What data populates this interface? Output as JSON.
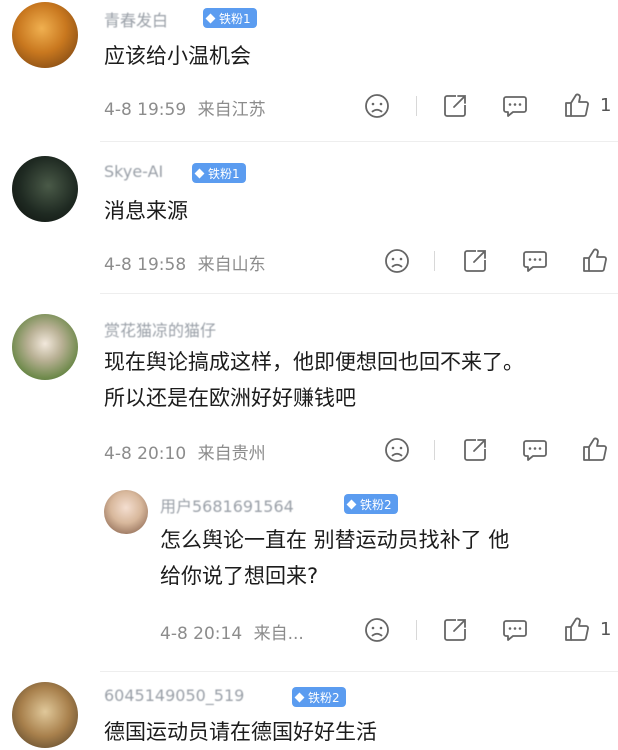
{
  "comments": [
    {
      "username": "青春发白",
      "badge": "铁粉1",
      "text_lines": [
        "应该给小温机会"
      ],
      "time": "4-8 19:59",
      "location": "来自江苏",
      "like_count": "1",
      "avatar_color": "#c9781f"
    },
    {
      "username": "Skye-AI",
      "badge": "铁粉1",
      "text_lines": [
        "消息来源"
      ],
      "time": "4-8 19:58",
      "location": "来自山东",
      "avatar_color": "#1f2a22"
    },
    {
      "username": "赏花猫凉的猫仔",
      "text_lines": [
        "现在舆论搞成这样，他即便想回也回不来了。",
        "所以还是在欧洲好好赚钱吧"
      ],
      "time": "4-8 20:10",
      "location": "来自贵州",
      "avatar_color": "#7f9a5c"
    },
    {
      "username": "用户5681691564",
      "badge": "铁粉2",
      "text_lines": [
        "怎么舆论一直在 别替运动员找补了 他",
        "给你说了想回来?"
      ],
      "time": "4-8 20:14",
      "location": "来自...",
      "like_count": "1",
      "avatar_color": "#d8b89c"
    },
    {
      "username": "6045149050_519",
      "badge": "铁粉2",
      "text_lines": [
        "德国运动员请在德国好好生活"
      ],
      "avatar_color": "#a8804c"
    }
  ],
  "icons": {
    "dislike": "dislike-face-icon",
    "share": "share-icon",
    "reply": "comment-icon",
    "like": "thumbs-up-icon"
  }
}
